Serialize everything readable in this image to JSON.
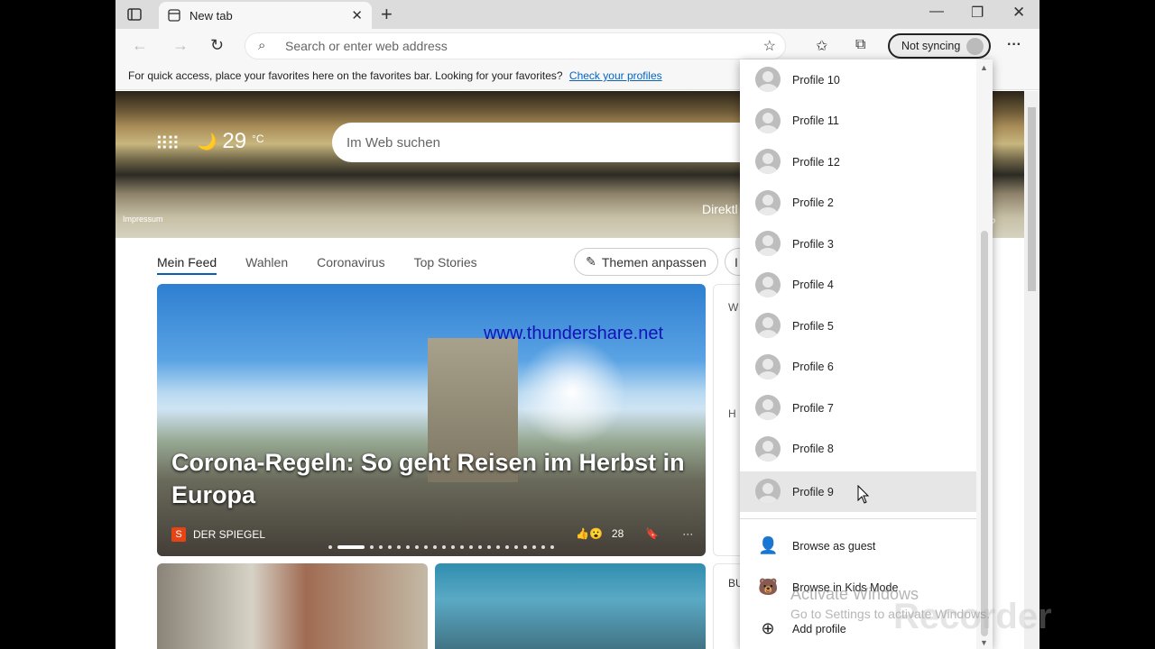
{
  "browser": {
    "tab_title": "New tab",
    "address_placeholder": "Search or enter web address",
    "sync_label": "Not syncing",
    "favbar_text": "For quick access, place your favorites here on the favorites bar. Looking for your favorites?",
    "favbar_link": "Check your profiles"
  },
  "hero": {
    "temperature": "29",
    "unit": "°C",
    "search_placeholder": "Im Web suchen",
    "impressum": "Impressum",
    "direkt": "Direktl",
    "right_text": "d?"
  },
  "feed": {
    "tabs": [
      "Mein Feed",
      "Wahlen",
      "Coronavirus",
      "Top Stories"
    ],
    "customize_label": "Themen anpassen",
    "partial_button": "I",
    "watermark": "www.thundershare.net",
    "headline": "Corona-Regeln: So geht Reisen im Herbst in Europa",
    "source": "DER SPIEGEL",
    "source_logo": "S",
    "reactions_count": "28",
    "more": "···",
    "side_card_letters": [
      "W",
      "H"
    ],
    "bottom_card_text": "BU"
  },
  "profile_menu": {
    "profiles": [
      "Profile 10",
      "Profile 11",
      "Profile 12",
      "Profile 2",
      "Profile 3",
      "Profile 4",
      "Profile 5",
      "Profile 6",
      "Profile 7",
      "Profile 8",
      "Profile 9"
    ],
    "hovered": "Profile 9",
    "actions": [
      "Browse as guest",
      "Browse in Kids Mode",
      "Add profile"
    ]
  },
  "overlay": {
    "activate_title": "Activate Windows",
    "activate_sub": "Go to Settings to activate Windows.",
    "recorder": "Recorder"
  },
  "colors": {
    "accent": "#0a5fb0",
    "link": "#0563c1",
    "watermark": "#1212b8"
  }
}
